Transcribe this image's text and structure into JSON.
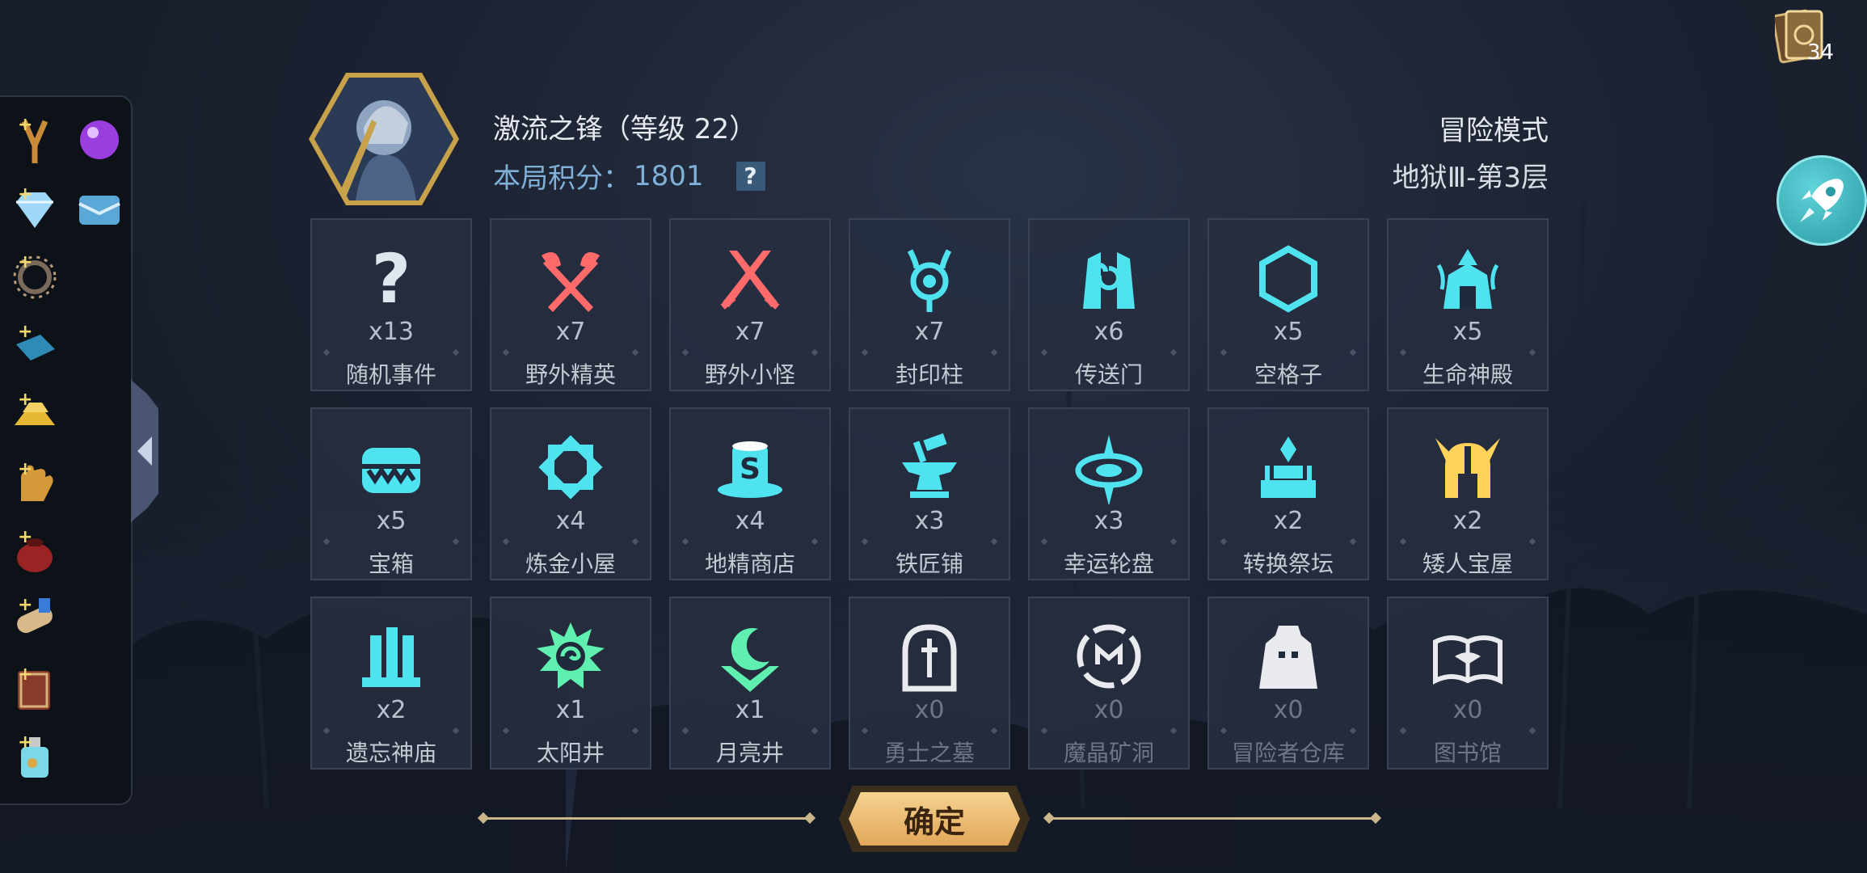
{
  "hero": {
    "name": "激流之锋（等级 22）",
    "score_label": "本局积分：",
    "score_value": "1801",
    "help_label": "?"
  },
  "mode": {
    "title": "冒险模式",
    "floor": "地狱Ⅲ-第3层"
  },
  "cards": {
    "count": "34",
    "icon": "cards-icon"
  },
  "rocket": {
    "icon": "rocket-icon"
  },
  "inventory": [
    {
      "icon": "slingshot-icon"
    },
    {
      "icon": "purple-orb-icon"
    },
    {
      "icon": "diamond-icon"
    },
    {
      "icon": "chest-plate-icon"
    },
    {
      "icon": "spiked-ring-icon"
    },
    {
      "icon": "blue-cloth-icon"
    },
    {
      "icon": "gold-bars-icon"
    },
    {
      "icon": "glove-icon"
    },
    {
      "icon": "red-pouch-icon"
    },
    {
      "icon": "scroll-icon"
    },
    {
      "icon": "book-icon"
    },
    {
      "icon": "potion-icon"
    }
  ],
  "locations": [
    {
      "count": "x13",
      "label": "随机事件",
      "icon": "question-mark-icon",
      "color": "#dfe6ee"
    },
    {
      "count": "x7",
      "label": "野外精英",
      "icon": "crossed-axes-icon",
      "color": "#ff6b6b"
    },
    {
      "count": "x7",
      "label": "野外小怪",
      "icon": "crossed-swords-icon",
      "color": "#ff6b6b"
    },
    {
      "count": "x7",
      "label": "封印柱",
      "icon": "seal-pillar-icon",
      "color": "#4fe3f0"
    },
    {
      "count": "x6",
      "label": "传送门",
      "icon": "portal-icon",
      "color": "#4fe3f0"
    },
    {
      "count": "x5",
      "label": "空格子",
      "icon": "hexagon-icon",
      "color": "#4fe3f0"
    },
    {
      "count": "x5",
      "label": "生命神殿",
      "icon": "life-temple-icon",
      "color": "#4fe3f0"
    },
    {
      "count": "x5",
      "label": "宝箱",
      "icon": "mimic-chest-icon",
      "color": "#4fe3f0"
    },
    {
      "count": "x4",
      "label": "炼金小屋",
      "icon": "alchemy-icon",
      "color": "#4fe3f0"
    },
    {
      "count": "x4",
      "label": "地精商店",
      "icon": "goblin-shop-icon",
      "color": "#4fe3f0"
    },
    {
      "count": "x3",
      "label": "铁匠铺",
      "icon": "anvil-icon",
      "color": "#4fe3f0"
    },
    {
      "count": "x3",
      "label": "幸运轮盘",
      "icon": "lucky-wheel-icon",
      "color": "#4fe3f0"
    },
    {
      "count": "x2",
      "label": "转换祭坛",
      "icon": "altar-icon",
      "color": "#4fe3f0"
    },
    {
      "count": "x2",
      "label": "矮人宝屋",
      "icon": "dwarf-helmet-icon",
      "color": "#ffd25a"
    },
    {
      "count": "x2",
      "label": "遗忘神庙",
      "icon": "forgotten-temple-icon",
      "color": "#4fe3f0"
    },
    {
      "count": "x1",
      "label": "太阳井",
      "icon": "sun-well-icon",
      "color": "#5ff0b0"
    },
    {
      "count": "x1",
      "label": "月亮井",
      "icon": "moon-well-icon",
      "color": "#5ff0b0"
    },
    {
      "count": "x0",
      "label": "勇士之墓",
      "icon": "tombstone-icon",
      "color": "#e8eaee"
    },
    {
      "count": "x0",
      "label": "魔晶矿洞",
      "icon": "crystal-mine-icon",
      "color": "#e8eaee"
    },
    {
      "count": "x0",
      "label": "冒险者仓库",
      "icon": "warehouse-icon",
      "color": "#e8eaee"
    },
    {
      "count": "x0",
      "label": "图书馆",
      "icon": "library-icon",
      "color": "#e8eaee"
    }
  ],
  "confirm_label": "确定"
}
